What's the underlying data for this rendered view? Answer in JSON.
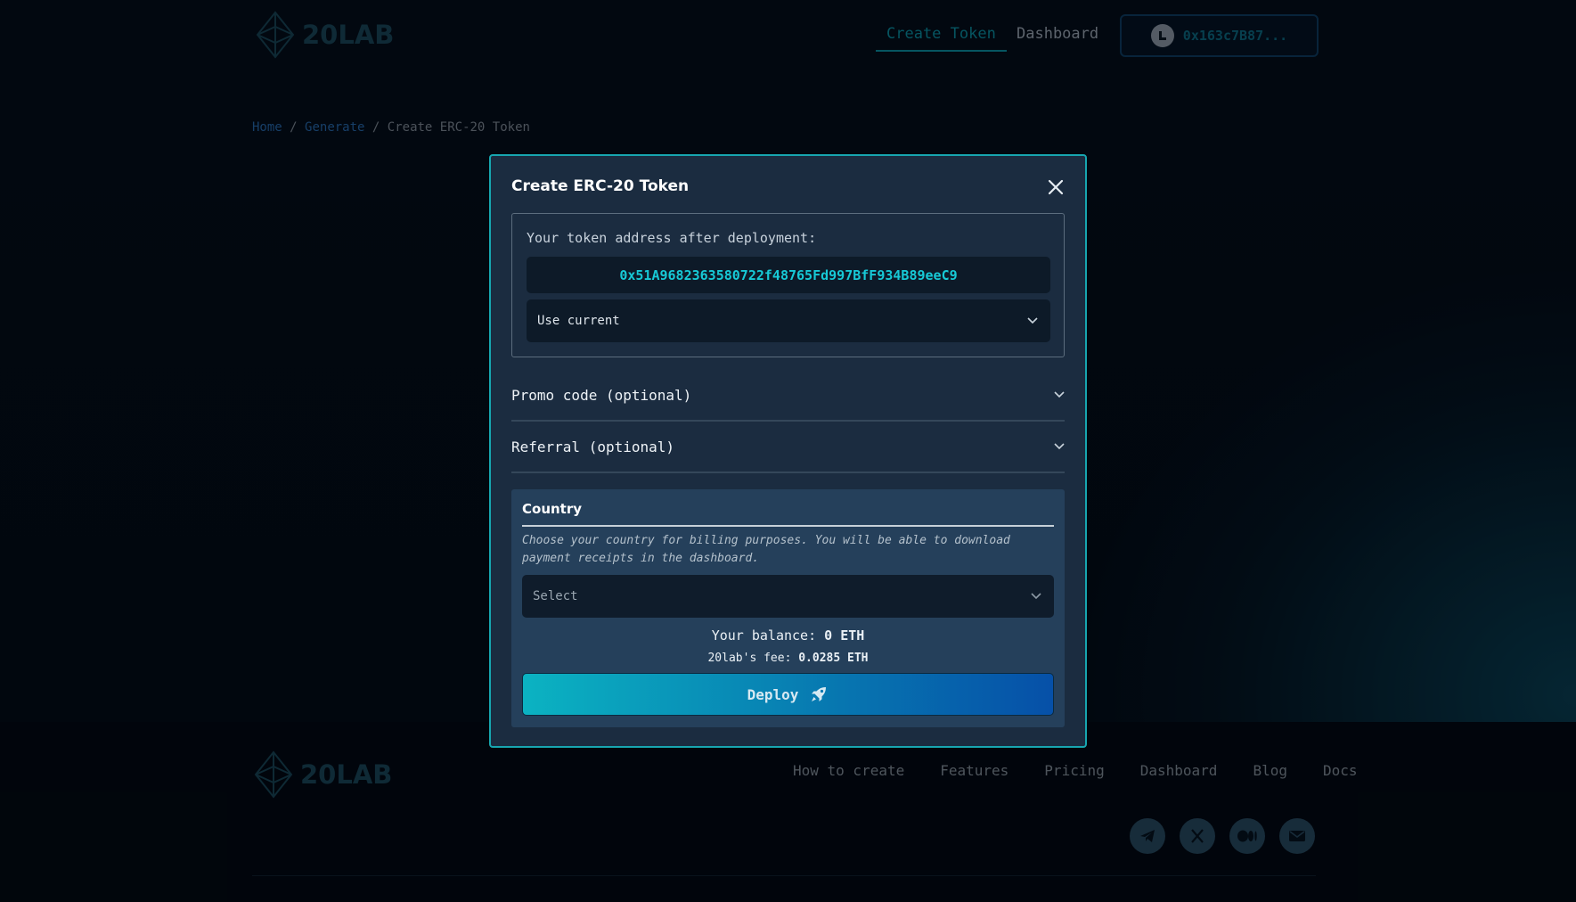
{
  "header": {
    "logo_text": "20LAB",
    "nav": [
      {
        "label": "Create Token",
        "active": true
      },
      {
        "label": "Dashboard",
        "active": false
      }
    ],
    "wallet": {
      "address": "0x163c7B87...",
      "icon": "wallet-avatar-icon"
    }
  },
  "breadcrumb": {
    "items": [
      "Home",
      "Generate",
      "Create ERC-20 Token"
    ],
    "separator": "/"
  },
  "modal": {
    "title": "Create ERC-20 Token",
    "close_icon": "close-icon",
    "address_label": "Your token address after deployment:",
    "address_value": "0x51A9682363580722f48765Fd997BfF934B89eeC9",
    "address_mode": "Use current",
    "promo_label": "Promo code (optional)",
    "referral_label": "Referral (optional)",
    "country": {
      "title": "Country",
      "help": "Choose your country for billing purposes. You will be able to download payment receipts in the dashboard.",
      "placeholder": "Select"
    },
    "balance": {
      "label": "Your balance:",
      "value": "0 ETH"
    },
    "fee": {
      "label": "20lab's fee:",
      "value": "0.0285 ETH"
    },
    "deploy_label": "Deploy",
    "deploy_icon": "rocket-icon"
  },
  "footer": {
    "logo_text": "20LAB",
    "links": [
      "How to create",
      "Features",
      "Pricing",
      "Dashboard",
      "Blog",
      "Docs"
    ],
    "social": [
      "telegram-icon",
      "x-icon",
      "medium-icon",
      "mail-icon"
    ]
  },
  "colors": {
    "accent": "#17a6b0",
    "address_text": "#17c9d6",
    "modal_bg": "#1b2c40",
    "deploy_gradient_start": "#0bb3c2",
    "deploy_gradient_end": "#0650a8"
  }
}
